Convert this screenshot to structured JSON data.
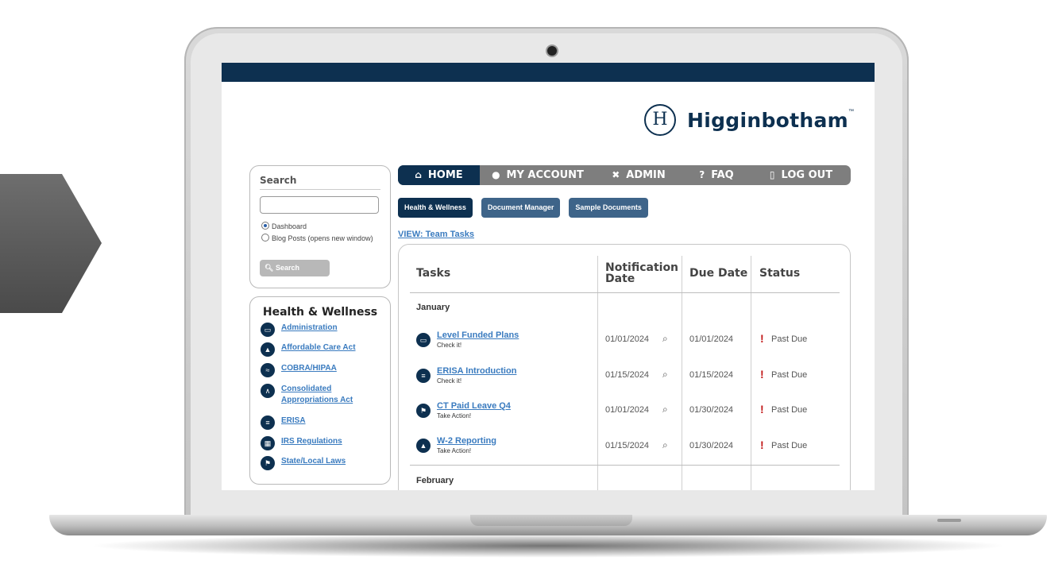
{
  "logo": {
    "mark": "H",
    "name": "Higginbotham",
    "tm": "™"
  },
  "search": {
    "title": "Search",
    "input_value": "",
    "options": [
      "Dashboard",
      "Blog Posts (opens new window)"
    ],
    "button": "Search"
  },
  "health": {
    "title": "Health & Wellness",
    "links": [
      {
        "label": "Administration",
        "icon": "folder-icon"
      },
      {
        "label": "Affordable Care Act",
        "icon": "capitol-icon"
      },
      {
        "label": "COBRA/HIPAA",
        "icon": "handshake-icon"
      },
      {
        "label": "Consolidated Appropriations Act",
        "icon": "compass-icon"
      },
      {
        "label": "ERISA",
        "icon": "document-icon"
      },
      {
        "label": "IRS Regulations",
        "icon": "calculator-icon"
      },
      {
        "label": "State/Local Laws",
        "icon": "flag-icon"
      }
    ]
  },
  "nav": [
    {
      "label": "HOME",
      "icon": "home-icon",
      "glyph": "🏠"
    },
    {
      "label": "MY ACCOUNT",
      "icon": "user-icon",
      "glyph": "👤"
    },
    {
      "label": "ADMIN",
      "icon": "tools-icon",
      "glyph": "✕"
    },
    {
      "label": "FAQ",
      "icon": "question-icon",
      "glyph": "?"
    },
    {
      "label": "LOG OUT",
      "icon": "door-icon",
      "glyph": "🚪"
    }
  ],
  "subtabs": [
    "Health & Wellness",
    "Document Manager",
    "Sample Documents"
  ],
  "view_link": "VIEW: Team Tasks",
  "table": {
    "headers": [
      "Tasks",
      "Notification Date",
      "Due Date",
      "Status"
    ],
    "months": [
      "January",
      "February"
    ],
    "rows": [
      {
        "task": "Level Funded Plans",
        "sub": "Check it!",
        "icon": "folder-icon",
        "notification": "01/01/2024",
        "due": "01/01/2024",
        "status": "Past Due"
      },
      {
        "task": "ERISA Introduction",
        "sub": "Check it!",
        "icon": "document-icon",
        "notification": "01/15/2024",
        "due": "01/15/2024",
        "status": "Past Due"
      },
      {
        "task": "CT Paid Leave Q4",
        "sub": "Take Action!",
        "icon": "flag-icon",
        "notification": "01/01/2024",
        "due": "01/30/2024",
        "status": "Past Due"
      },
      {
        "task": "W-2 Reporting",
        "sub": "Take Action!",
        "icon": "capitol-icon",
        "notification": "01/15/2024",
        "due": "01/30/2024",
        "status": "Past Due"
      }
    ]
  },
  "colors": {
    "navy": "#0d3050",
    "link": "#3a7bbf",
    "alert": "#c21a1a",
    "nav_gray": "#7e7e7e"
  }
}
